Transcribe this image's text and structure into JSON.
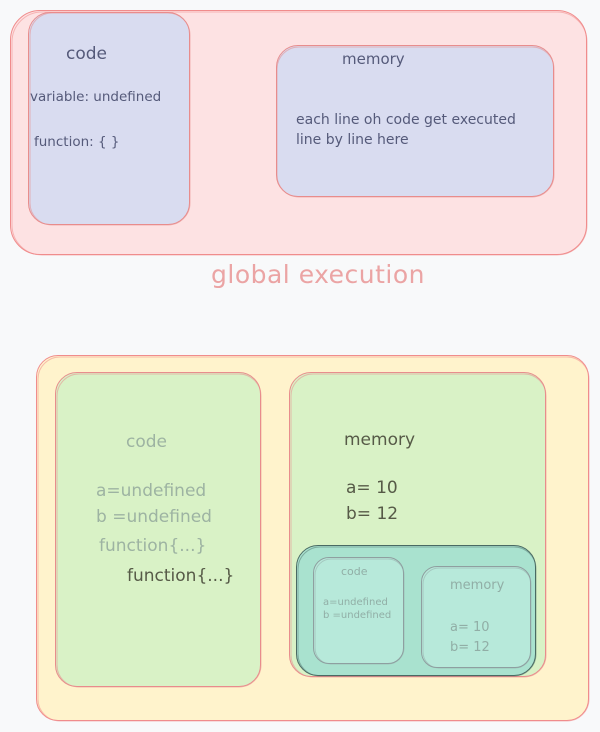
{
  "global_diagram": {
    "caption": "global execution",
    "code_box": {
      "title": "code",
      "variable_line": "variable: undefined",
      "function_line": "function: { }"
    },
    "memory_box": {
      "title": "memory",
      "description_line1": "each line oh code get executed",
      "description_line2": "line by line here"
    }
  },
  "second_diagram": {
    "code_box": {
      "title": "code",
      "a_line": "a=undefined",
      "b_line": "b =undefined",
      "function_line1": "function{...}",
      "function_line2": "function{...}"
    },
    "memory_box": {
      "title": "memory",
      "a_line": "a= 10",
      "b_line": "b= 12"
    },
    "nested_context": {
      "code_box": {
        "title": "code",
        "a_line": "a=undefined",
        "b_line": "b =undefined"
      },
      "memory_box": {
        "title": "memory",
        "a_line": "a= 10",
        "b_line": "b= 12"
      }
    }
  },
  "colors": {
    "background": "#f8f9fa",
    "global_fill": "#fde2e3",
    "global_stroke": "#f08c8c",
    "lavender_fill": "#d9dcf0",
    "yellow_fill": "#fff3cc",
    "green_fill": "#d9f2c6",
    "teal_fill": "#a9e2cf",
    "caption_color": "#eba4a4"
  }
}
